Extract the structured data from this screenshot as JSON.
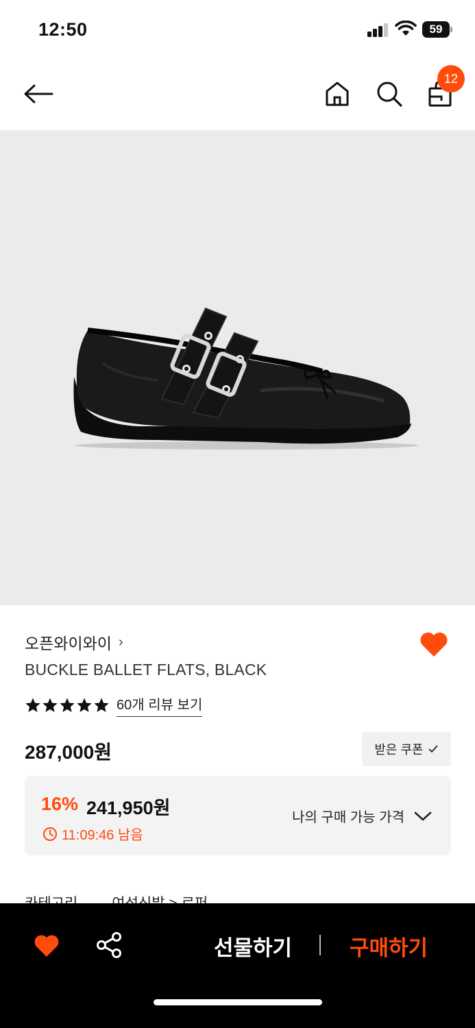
{
  "status_bar": {
    "time": "12:50",
    "battery": "59"
  },
  "nav": {
    "back_icon": "arrow-left-icon",
    "home_icon": "home-icon",
    "search_icon": "search-icon",
    "cart_icon": "shopping-bag-icon",
    "cart_count": "12"
  },
  "product": {
    "image_icon": "black-buckle-ballet-flat-image",
    "brand": "오픈와이와이",
    "brand_chevron": "›",
    "name": "BUCKLE BALLET FLATS, BLACK",
    "rating_stars": 5,
    "review_link": "60개 리뷰 보기",
    "price": "287,000원",
    "coupon_label": "받은 쿠폰",
    "wishlisted": true
  },
  "discount": {
    "rate": "16%",
    "price": "241,950원",
    "timer": "11:09:46 남음",
    "my_price_label": "나의 구매 가능 가격"
  },
  "category": {
    "label": "카테고리",
    "path": "여성신발 > 로퍼"
  },
  "bottom_bar": {
    "gift_label": "선물하기",
    "buy_label": "구매하기"
  },
  "colors": {
    "accent": "#ff4c0d",
    "image_bg": "#ebebeb",
    "bottom_bar_bg": "#000000"
  }
}
